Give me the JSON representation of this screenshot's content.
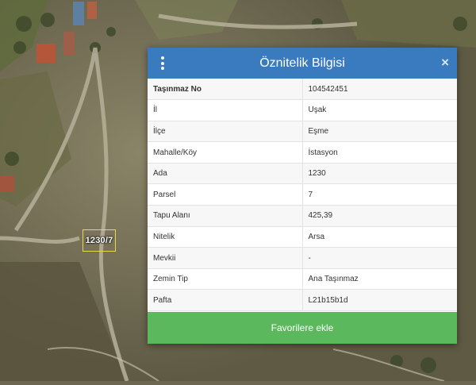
{
  "map": {
    "parcel_label": "1230/7"
  },
  "popup": {
    "title": "Öznitelik Bilgisi",
    "close_symbol": "×",
    "rows": [
      {
        "key": "Taşınmaz No",
        "value": "104542451"
      },
      {
        "key": "İl",
        "value": "Uşak"
      },
      {
        "key": "İlçe",
        "value": "Eşme"
      },
      {
        "key": "Mahalle/Köy",
        "value": "İstasyon"
      },
      {
        "key": "Ada",
        "value": "1230"
      },
      {
        "key": "Parsel",
        "value": "7"
      },
      {
        "key": "Tapu Alanı",
        "value": "425,39"
      },
      {
        "key": "Nitelik",
        "value": "Arsa"
      },
      {
        "key": "Mevkii",
        "value": "-"
      },
      {
        "key": "Zemin Tip",
        "value": "Ana Taşınmaz"
      },
      {
        "key": "Pafta",
        "value": "L21b15b1d"
      }
    ],
    "favorite_button": "Favorilere ekle"
  },
  "colors": {
    "header": "#3a7bbf",
    "button": "#5cb85c"
  },
  "icons": {
    "menu": "vertical-ellipsis-icon",
    "close": "close-icon"
  }
}
